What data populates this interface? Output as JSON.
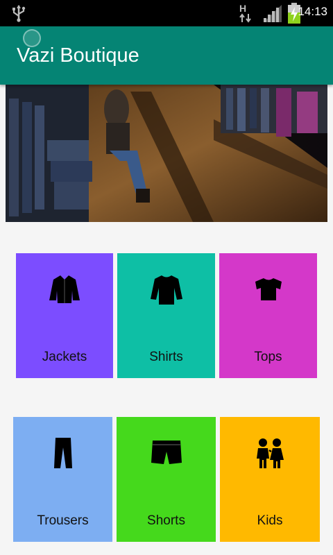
{
  "status_bar": {
    "time": "14:13",
    "network_type": "H",
    "icons": [
      "usb-icon",
      "network-type-icon",
      "signal-icon",
      "battery-charging-icon"
    ]
  },
  "app_bar": {
    "title": "Vazi Boutique"
  },
  "hero": {
    "description_icon": "store-interior-image"
  },
  "categories": [
    {
      "label": "Jackets",
      "color": "#7c4dff",
      "icon": "jacket-icon"
    },
    {
      "label": "Shirts",
      "color": "#0ebfa5",
      "icon": "shirt-icon"
    },
    {
      "label": "Tops",
      "color": "#d438c9",
      "icon": "top-icon"
    },
    {
      "label": "Trousers",
      "color": "#7daef2",
      "icon": "trousers-icon"
    },
    {
      "label": "Shorts",
      "color": "#45d91c",
      "icon": "shorts-icon"
    },
    {
      "label": "Kids",
      "color": "#ffb900",
      "icon": "kids-icon"
    }
  ]
}
